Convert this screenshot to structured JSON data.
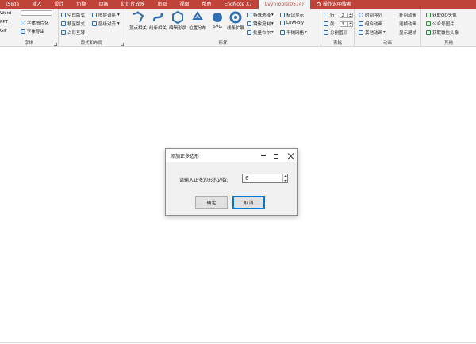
{
  "tabs": [
    {
      "label": "iSlide",
      "active": false
    },
    {
      "label": "插入",
      "active": false
    },
    {
      "label": "设计",
      "active": false
    },
    {
      "label": "切换",
      "active": false
    },
    {
      "label": "动画",
      "active": false
    },
    {
      "label": "幻灯片放映",
      "active": false
    },
    {
      "label": "审阅",
      "active": false
    },
    {
      "label": "视图",
      "active": false
    },
    {
      "label": "帮助",
      "active": false
    },
    {
      "label": "EndNote X7",
      "active": false
    },
    {
      "label": "LvyhTools(0514)",
      "active": true
    },
    {
      "label": "操作说明搜索",
      "active": false,
      "icon": "lightbulb-icon"
    }
  ],
  "ribbon": {
    "font_group": {
      "label": "字体",
      "items": [
        "Word",
        "PPT",
        "GIF",
        "字体图片化",
        "字体导出"
      ],
      "combo_value": ""
    },
    "layout_group": {
      "label": "版式和布局",
      "items": [
        "空白版式",
        "移至版式",
        "占形互转",
        "图层调序",
        "层级对齐"
      ]
    },
    "shape_group": {
      "label": "形状",
      "big_buttons": [
        "顶点相关",
        "线条相关",
        "编辑形状",
        "位置分布",
        "SVG",
        "线条扩展"
      ],
      "small_items": [
        "特殊选择",
        "镜像复制",
        "批量布尔",
        "标记显示",
        "LowPoly",
        "平铺网格"
      ]
    },
    "table_group": {
      "label": "表格",
      "items": [
        "行",
        "列",
        "分割图形"
      ],
      "row_value": "2",
      "col_value": "3"
    },
    "anim_group": {
      "label": "动画",
      "items": [
        "时间序列",
        "组合动画",
        "其他动画",
        "补间动画",
        "逐帧动画",
        "显示尾帧"
      ]
    },
    "other_group": {
      "label": "其他",
      "items": [
        "获取QQ头像",
        "公众号图片",
        "获取微信头像"
      ]
    }
  },
  "dialog": {
    "title": "添加正多边形",
    "prompt": "请输入正多边形的边数:",
    "value": "6",
    "ok_label": "确定",
    "cancel_label": "取消"
  },
  "colors": {
    "tabbar": "#c0433a",
    "ribbon_bg": "#f3f3f3",
    "accent": "#0078d7"
  }
}
